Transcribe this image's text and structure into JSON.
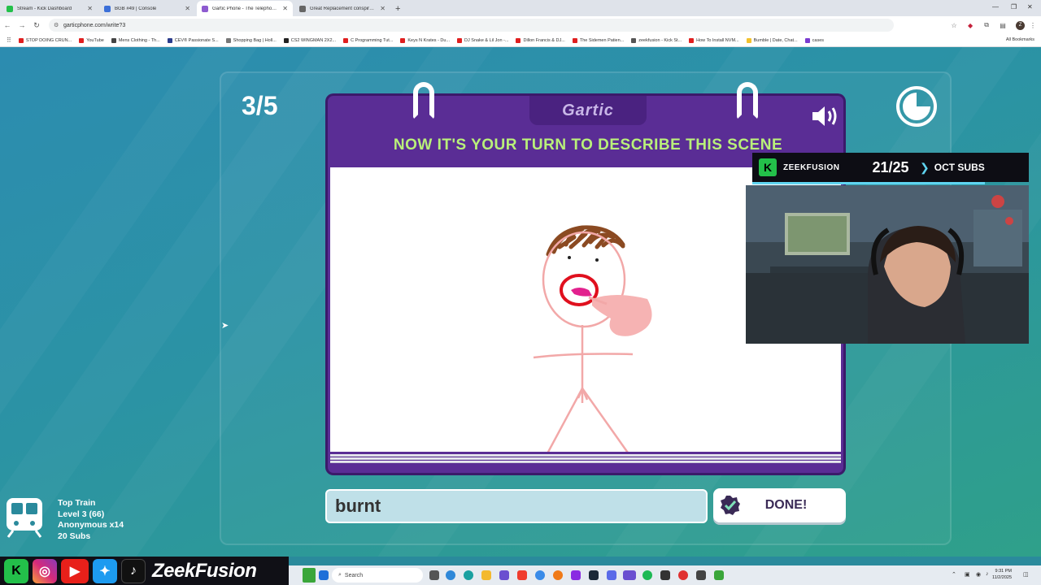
{
  "browser": {
    "tabs": [
      {
        "label": "Stream - Kick Dashboard",
        "color": "#23c04a",
        "active": false
      },
      {
        "label": "BGB #49 | Console",
        "color": "#3b6fd8",
        "active": false
      },
      {
        "label": "Gartic Phone - The Telephone G",
        "color": "#8e5bd0",
        "active": true
      },
      {
        "label": "Great Replacement conspiracy",
        "color": "#666666",
        "active": false
      }
    ],
    "url": "garticphone.com/write?3",
    "bookmarks": [
      {
        "label": "STOP DOING CRUN...",
        "color": "#e01f1f"
      },
      {
        "label": "YouTube",
        "color": "#e01f1f"
      },
      {
        "label": "Mens Clothing - Th...",
        "color": "#444444"
      },
      {
        "label": "CEV® Passionate S...",
        "color": "#2b3c8c"
      },
      {
        "label": "Shopping Bag | Holl...",
        "color": "#777777"
      },
      {
        "label": "CS2 WINGMAN 2X2...",
        "color": "#222222"
      },
      {
        "label": "C Programming Tut...",
        "color": "#e01f1f"
      },
      {
        "label": "Keys N Krates - Du...",
        "color": "#e01f1f"
      },
      {
        "label": "DJ Snake & Lil Jon -...",
        "color": "#e01f1f"
      },
      {
        "label": "Dillon Francis & DJ...",
        "color": "#e01f1f"
      },
      {
        "label": "The Sidemen Patien...",
        "color": "#e01f1f"
      },
      {
        "label": "zeekfusion - Kick St...",
        "color": "#555555"
      },
      {
        "label": "How To Install NVM...",
        "color": "#e01f1f"
      },
      {
        "label": "Bumble | Date, Chat...",
        "color": "#f2c12e"
      },
      {
        "label": "cases",
        "color": "#7a3cd0"
      }
    ],
    "all_bookmarks": "All Bookmarks"
  },
  "game": {
    "round": "3/5",
    "logo": "Gartic",
    "instruction": "NOW IT'S YOUR TURN TO DESCRIBE THIS SCENE",
    "answer": "burnt",
    "done_label": "DONE!",
    "timer_elapsed_fraction": 0.25
  },
  "overlay": {
    "sub_name": "ZEEKFUSION",
    "sub_count": "21/25",
    "sub_label": "OCT SUBS",
    "sub_progress_fraction": 0.84,
    "train": {
      "title": "Top Train",
      "level": "Level 3  (66)",
      "anon": "Anonymous x14",
      "subs": "20 Subs"
    },
    "social_name": "ZeekFusion"
  },
  "taskbar": {
    "search_placeholder": "Search",
    "time": "9:31 PM",
    "date": "11/2/2025"
  },
  "colors": {
    "book_purple": "#5a2d95",
    "instruction_green": "#b9f07a",
    "kick_green": "#23c04a"
  }
}
